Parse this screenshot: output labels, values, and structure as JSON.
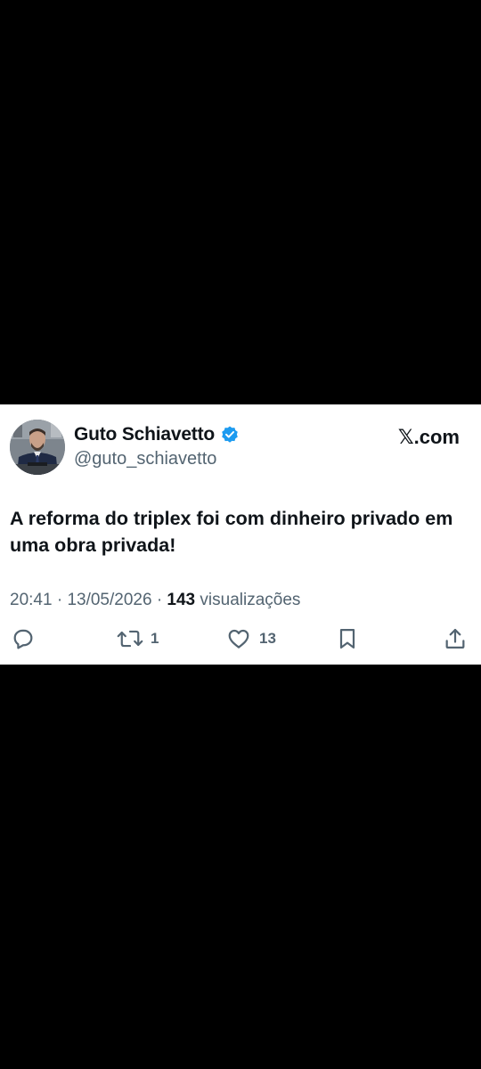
{
  "tweet": {
    "author": {
      "display_name": "Guto Schiavetto",
      "handle": "@guto_schiavetto",
      "verified": true
    },
    "brand": "𝕏.com",
    "text": "A reforma do triplex foi com dinheiro privado em uma obra privada!",
    "meta": {
      "time": "20:41",
      "date": "13/05/2026",
      "views_count": "143",
      "views_label": "visualizações"
    },
    "actions": {
      "reply": {
        "icon": "reply-icon"
      },
      "retweet": {
        "icon": "retweet-icon",
        "count": "1"
      },
      "like": {
        "icon": "heart-icon",
        "count": "13"
      },
      "bookmark": {
        "icon": "bookmark-icon"
      },
      "share": {
        "icon": "share-icon"
      }
    }
  },
  "colors": {
    "background": "#000000",
    "card": "#ffffff",
    "text_primary": "#0f1419",
    "text_secondary": "#536471",
    "verified": "#1d9bf0"
  }
}
